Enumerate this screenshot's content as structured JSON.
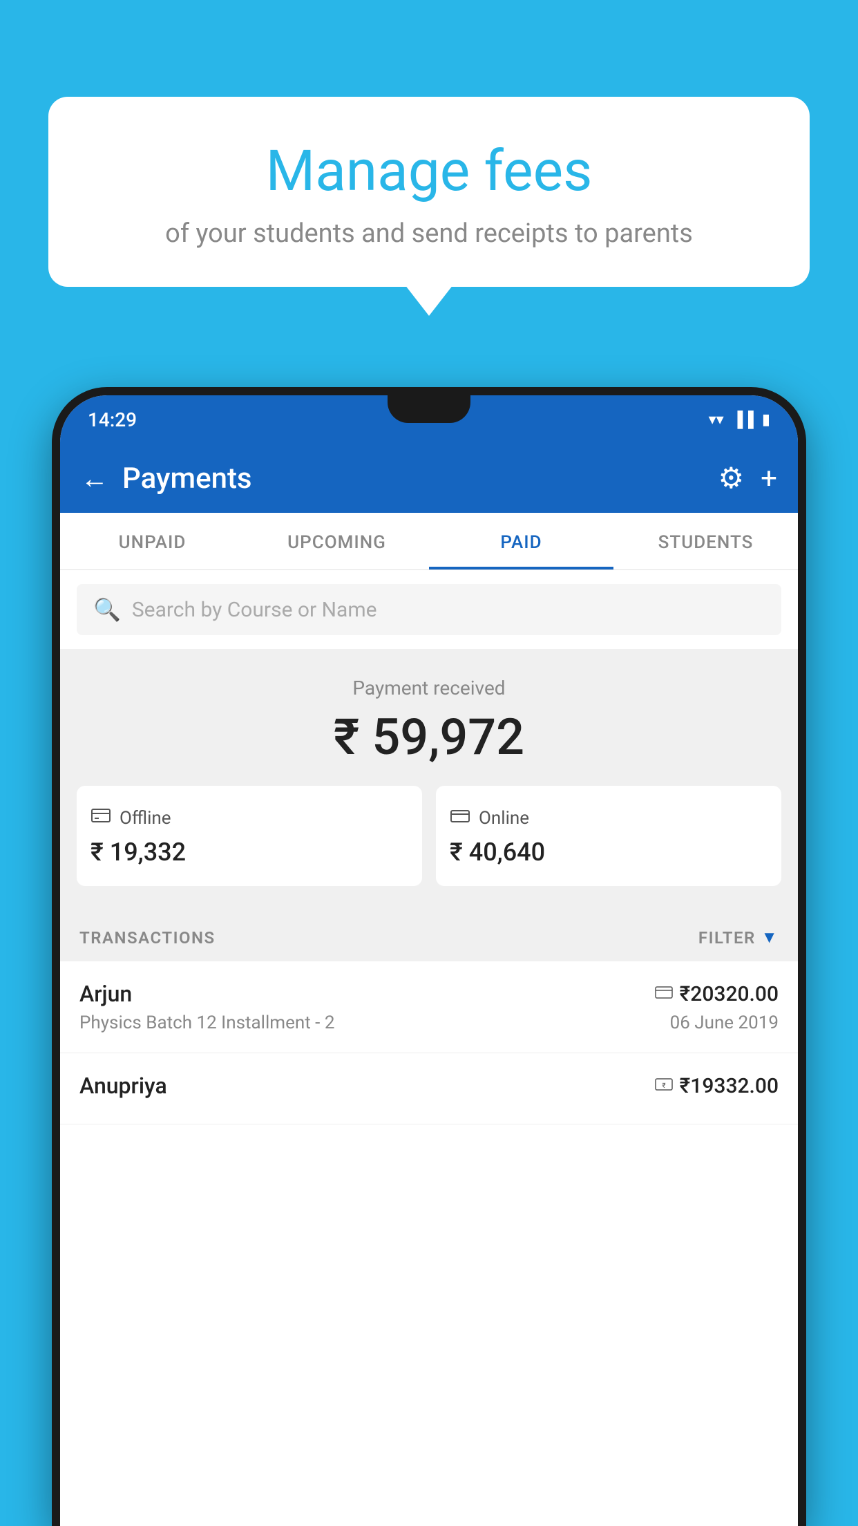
{
  "background_color": "#29b6e8",
  "speech_bubble": {
    "heading": "Manage fees",
    "subtext": "of your students and send receipts to parents"
  },
  "status_bar": {
    "time": "14:29",
    "icons": [
      "▼",
      "◀",
      "▐"
    ]
  },
  "app_header": {
    "back_label": "←",
    "title": "Payments",
    "gear_label": "⚙",
    "plus_label": "+"
  },
  "tabs": [
    {
      "label": "UNPAID",
      "active": false
    },
    {
      "label": "UPCOMING",
      "active": false
    },
    {
      "label": "PAID",
      "active": true
    },
    {
      "label": "STUDENTS",
      "active": false
    }
  ],
  "search": {
    "placeholder": "Search by Course or Name"
  },
  "payment_summary": {
    "label": "Payment received",
    "total_amount": "₹ 59,972",
    "offline": {
      "icon": "💳",
      "label": "Offline",
      "amount": "₹ 19,332"
    },
    "online": {
      "icon": "💳",
      "label": "Online",
      "amount": "₹ 40,640"
    }
  },
  "transactions_section": {
    "label": "TRANSACTIONS",
    "filter_label": "FILTER"
  },
  "transactions": [
    {
      "name": "Arjun",
      "amount": "₹20320.00",
      "course": "Physics Batch 12 Installment - 2",
      "date": "06 June 2019",
      "payment_icon": "💳"
    },
    {
      "name": "Anupriya",
      "amount": "₹19332.00",
      "course": "",
      "date": "",
      "payment_icon": "💴"
    }
  ]
}
